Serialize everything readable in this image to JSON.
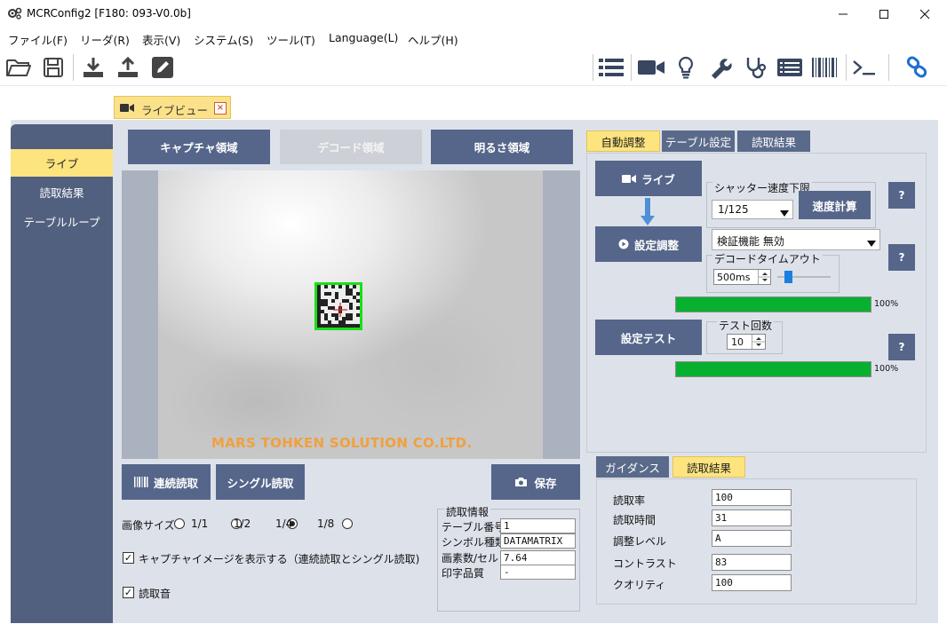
{
  "window": {
    "title": "MCRConfig2 [F180: 093-V0.0b]"
  },
  "menu": [
    "ファイル(F)",
    "リーダ(R)",
    "表示(V)",
    "システム(S)",
    "ツール(T)",
    "Language(L)",
    "ヘルプ(H)"
  ],
  "doc_tab": {
    "label": "ライブビュー"
  },
  "nav": {
    "items": [
      "ライブ",
      "読取結果",
      "テーブルループ"
    ],
    "active_index": 0
  },
  "region_buttons": {
    "capture": "キャプチャ領域",
    "decode": "デコード領域",
    "brightness": "明るさ領域"
  },
  "camera": {
    "watermark": "MARS TOHKEN SOLUTION CO.LTD."
  },
  "actions": {
    "continuous": "連続読取",
    "single": "シングル読取",
    "save": "保存"
  },
  "image_size": {
    "label": "画像サイズ",
    "options": [
      "1/1",
      "1/2",
      "1/4",
      "1/8"
    ],
    "selected_index": 2
  },
  "checkboxes": {
    "show_capture": "キャプチャイメージを表示する（連続読取とシングル読取)",
    "read_sound": "読取音"
  },
  "read_info": {
    "title": "読取情報",
    "rows": [
      {
        "label": "テーブル番号",
        "value": "1"
      },
      {
        "label": "シンボル種類",
        "value": "DATAMATRIX"
      },
      {
        "label": "画素数/セル",
        "value": "7.64"
      },
      {
        "label": "印字品質",
        "value": "-"
      }
    ]
  },
  "right_tabs": {
    "items": [
      "自動調整",
      "テーブル設定",
      "読取結果"
    ],
    "active_index": 0
  },
  "auto_adjust": {
    "live_button": "ライブ",
    "shutter_group": "シャッター速度下限",
    "shutter_value": "1/125",
    "speed_calc_button": "速度計算",
    "help": "?",
    "adjust_button": "設定調整",
    "verify_value": "検証機能 無効",
    "decode_timeout_group": "デコードタイムアウト",
    "decode_timeout_value": "500ms",
    "decode_timeout_level": 0.05,
    "progress1_pct": "100%",
    "progress1_value": 100,
    "test_button": "設定テスト",
    "test_count_group": "テスト回数",
    "test_count_value": "10",
    "progress2_pct": "100%",
    "progress2_value": 100
  },
  "bottom_tabs": {
    "items": [
      "ガイダンス",
      "読取結果"
    ],
    "active_index": 1
  },
  "results": [
    {
      "label": "読取率",
      "value": "100"
    },
    {
      "label": "読取時間",
      "value": "31"
    },
    {
      "label": "調整レベル",
      "value": "A"
    },
    {
      "label": "コントラスト",
      "value": "83"
    },
    {
      "label": "クオリティ",
      "value": "100"
    }
  ],
  "colors": {
    "accent_yellow": "#fde47f",
    "nav_blue": "#51607f",
    "button_blue": "#55668a",
    "progress_green": "#08b030",
    "detect_green": "#18e018",
    "watermark_orange": "#f0a040",
    "link_blue": "#1e6fd0"
  }
}
